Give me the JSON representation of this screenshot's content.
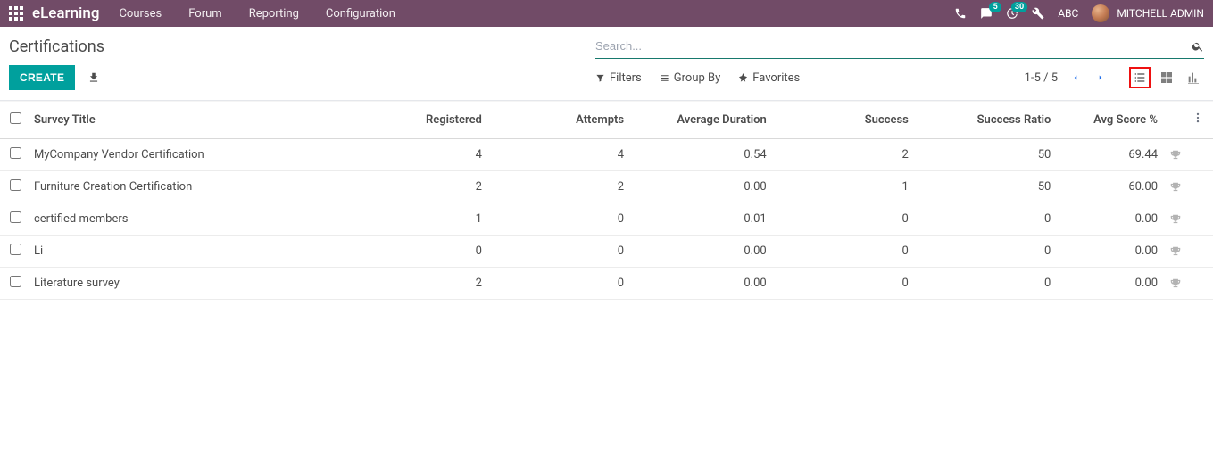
{
  "topbar": {
    "brand": "eLearning",
    "menu": [
      "Courses",
      "Forum",
      "Reporting",
      "Configuration"
    ],
    "chat_badge": "5",
    "clock_badge": "30",
    "company": "ABC",
    "username": "MITCHELL ADMIN"
  },
  "header": {
    "title": "Certifications",
    "search_placeholder": "Search...",
    "create_label": "CREATE",
    "filters_label": "Filters",
    "groupby_label": "Group By",
    "favorites_label": "Favorites",
    "pager": "1-5 / 5"
  },
  "table": {
    "columns": {
      "title": "Survey Title",
      "registered": "Registered",
      "attempts": "Attempts",
      "avg_duration": "Average Duration",
      "success": "Success",
      "success_ratio": "Success Ratio",
      "avg_score": "Avg Score %"
    },
    "rows": [
      {
        "title": "MyCompany Vendor Certification",
        "registered": "4",
        "attempts": "4",
        "avg_duration": "0.54",
        "success": "2",
        "success_ratio": "50",
        "avg_score": "69.44"
      },
      {
        "title": "Furniture Creation Certification",
        "registered": "2",
        "attempts": "2",
        "avg_duration": "0.00",
        "success": "1",
        "success_ratio": "50",
        "avg_score": "60.00"
      },
      {
        "title": "certified members",
        "registered": "1",
        "attempts": "0",
        "avg_duration": "0.01",
        "success": "0",
        "success_ratio": "0",
        "avg_score": "0.00"
      },
      {
        "title": "Li",
        "registered": "0",
        "attempts": "0",
        "avg_duration": "0.00",
        "success": "0",
        "success_ratio": "0",
        "avg_score": "0.00"
      },
      {
        "title": "Literature survey",
        "registered": "2",
        "attempts": "0",
        "avg_duration": "0.00",
        "success": "0",
        "success_ratio": "0",
        "avg_score": "0.00"
      }
    ]
  }
}
